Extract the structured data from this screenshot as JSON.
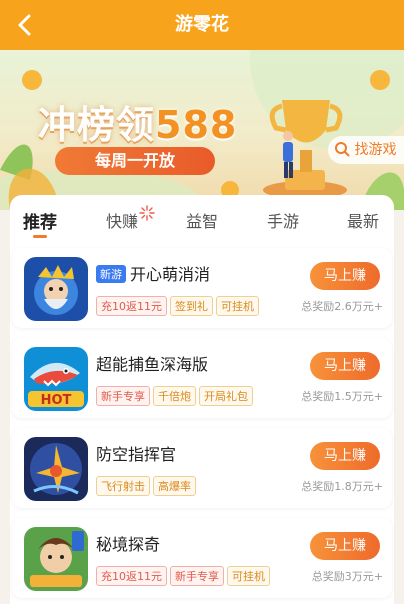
{
  "header": {
    "title": "游零花"
  },
  "banner": {
    "headline_prefix": "冲榜领",
    "headline_amount": "588",
    "button_label": "每周一开放",
    "find_game_label": "找游戏"
  },
  "tabs": [
    {
      "label": "推荐"
    },
    {
      "label": "快赚"
    },
    {
      "label": "益智"
    },
    {
      "label": "手游"
    },
    {
      "label": "最新"
    }
  ],
  "games": [
    {
      "badge": "新游",
      "name": "开心萌消消",
      "tags": [
        "充10返11元",
        "签到礼",
        "可挂机"
      ],
      "action": "马上赚",
      "reward": "总奖励2.6万元+"
    },
    {
      "name": "超能捕鱼深海版",
      "tags": [
        "新手专享",
        "千倍炮",
        "开局礼包"
      ],
      "action": "马上赚",
      "reward": "总奖励1.5万元+",
      "icon_text": "HOT"
    },
    {
      "name": "防空指挥官",
      "tags": [
        "飞行射击",
        "高爆率"
      ],
      "action": "马上赚",
      "reward": "总奖励1.8万元+"
    },
    {
      "name": "秘境探奇",
      "tags": [
        "充10返11元",
        "新手专享",
        "可挂机"
      ],
      "action": "马上赚",
      "reward": "总奖励3万元+"
    }
  ]
}
